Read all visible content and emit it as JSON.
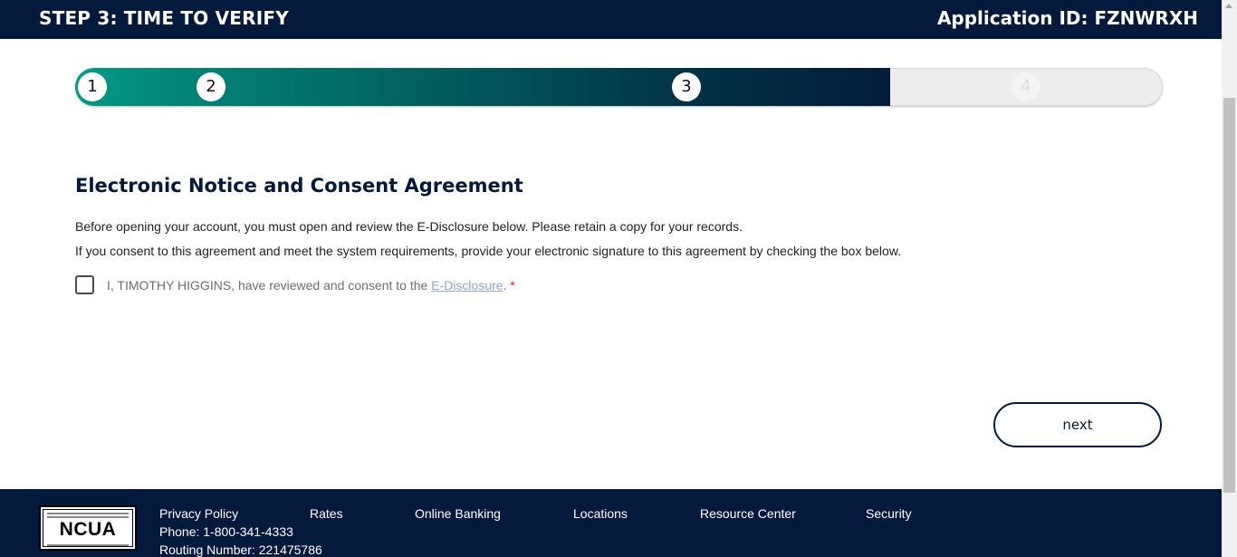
{
  "header": {
    "step_title": "STEP 3: TIME TO VERIFY",
    "application_id": "Application ID: FZNWRXH"
  },
  "progress": {
    "steps": [
      "1",
      "2",
      "3",
      "4"
    ],
    "current_step": 3,
    "filled_fraction": 0.75
  },
  "content": {
    "title": "Electronic Notice and Consent Agreement",
    "paragraph1": "Before opening your account, you must open and review the E-Disclosure below. Please retain a copy for your records.",
    "paragraph2": "If you consent to this agreement and meet the system requirements, provide your electronic signature to this agreement by checking the box below.",
    "consent_prefix": "I, TIMOTHY HIGGINS, have reviewed and consent to the ",
    "consent_link": "E-Disclosure",
    "consent_suffix": ".",
    "required_marker": "*",
    "consent_checked": false
  },
  "actions": {
    "next_label": "next"
  },
  "footer": {
    "logo_text": "NCUA",
    "links": [
      "Privacy Policy",
      "Rates",
      "Online Banking",
      "Locations",
      "Resource Center",
      "Security"
    ],
    "phone": "Phone: 1-800-341-4333",
    "routing": "Routing Number: 221475786"
  },
  "colors": {
    "navy": "#031a3c",
    "teal": "#049a86",
    "link": "#8fa3dc",
    "required": "#e02020"
  },
  "icons": {
    "checkbox": "checkbox-unchecked-icon",
    "scroll_up": "scroll-up-arrow-icon"
  }
}
